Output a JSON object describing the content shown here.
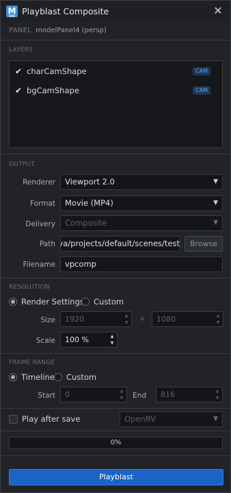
{
  "window": {
    "title": "Playblast Composite",
    "app_icon_letter": "M",
    "app_icon_sub": "XXX"
  },
  "panel": {
    "label": "PANEL",
    "value": "modelPanel4 (persp)"
  },
  "layers": {
    "section_label": "LAYERS",
    "items": [
      {
        "name": "charCamShape",
        "checked": true,
        "badge": "CAM"
      },
      {
        "name": "bgCamShape",
        "checked": true,
        "badge": "CAM"
      }
    ]
  },
  "output": {
    "section_label": "OUTPUT",
    "renderer": {
      "label": "Renderer",
      "value": "Viewport 2.0"
    },
    "format": {
      "label": "Format",
      "value": "Movie (MP4)"
    },
    "delivery": {
      "label": "Delivery",
      "value": "Composite",
      "disabled": true
    },
    "path": {
      "label": "Path",
      "value": "aya/projects/default/scenes/test",
      "browse_label": "Browse"
    },
    "filename": {
      "label": "Filename",
      "value": "vpcomp"
    }
  },
  "resolution": {
    "section_label": "RESOLUTION",
    "options": [
      {
        "label": "Render Settings",
        "selected": true
      },
      {
        "label": "Custom",
        "selected": false
      }
    ],
    "size": {
      "label": "Size",
      "width": "1920",
      "height": "1080",
      "separator": "×"
    },
    "scale": {
      "label": "Scale",
      "value": "100 %"
    }
  },
  "frame_range": {
    "section_label": "FRAME RANGE",
    "options": [
      {
        "label": "Timeline",
        "selected": true
      },
      {
        "label": "Custom",
        "selected": false
      }
    ],
    "start": {
      "label": "Start",
      "value": "0"
    },
    "end": {
      "label": "End",
      "value": "816"
    }
  },
  "play_after_save": {
    "label": "Play after save",
    "checked": false,
    "player": "OpenRV"
  },
  "progress": {
    "value": 0,
    "text": "0%"
  },
  "actions": {
    "primary_label": "Playblast"
  },
  "colors": {
    "accent": "#1c63c4",
    "badge_bg": "#1d3a57",
    "badge_fg": "#5fa4e0",
    "background": "#212327"
  }
}
